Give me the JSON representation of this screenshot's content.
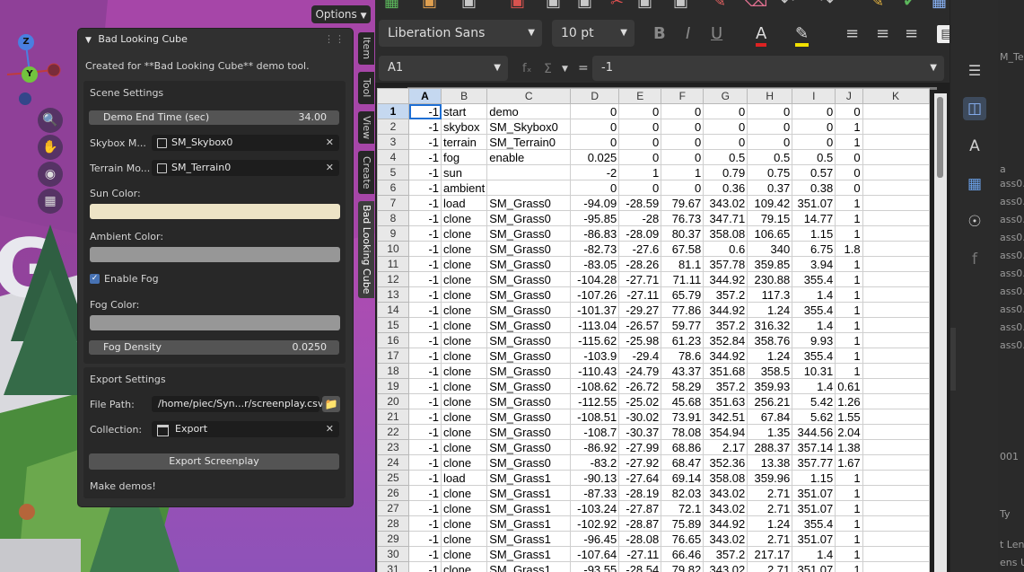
{
  "viewport": {
    "options_label": "Options",
    "axis_z": "Z",
    "axis_y": "Y",
    "nav_icons": [
      "zoom-icon",
      "hand-pan-icon",
      "camera-icon",
      "grid-icon"
    ]
  },
  "panel": {
    "title": "Bad Looking Cube",
    "description": "Created for **Bad Looking Cube** demo tool.",
    "scene_settings": {
      "header": "Scene Settings",
      "demo_end_time_label": "Demo End Time (sec)",
      "demo_end_time_value": "34.00",
      "skybox_label": "Skybox M...",
      "skybox_value": "SM_Skybox0",
      "terrain_label": "Terrain Mo...",
      "terrain_value": "SM_Terrain0",
      "sun_color_label": "Sun Color:",
      "sun_color": "#ede4c6",
      "ambient_color_label": "Ambient Color:",
      "ambient_color": "#979797",
      "enable_fog_label": "Enable Fog",
      "enable_fog": true,
      "fog_color_label": "Fog Color:",
      "fog_color": "#979797",
      "fog_density_label": "Fog Density",
      "fog_density_value": "0.0250"
    },
    "export_settings": {
      "header": "Export Settings",
      "file_path_label": "File Path:",
      "file_path_value": "/home/piec/Syn...r/screenplay.csv",
      "collection_label": "Collection:",
      "collection_value": "Export",
      "export_button": "Export Screenplay",
      "footer_text": "Make demos!"
    }
  },
  "side_tabs": [
    "Item",
    "Tool",
    "View",
    "Create",
    "Bad Looking Cube"
  ],
  "sheet": {
    "font_name": "Liberation Sans",
    "font_size": "10 pt",
    "cell_ref": "A1",
    "formula_value": "-1",
    "columns": [
      "A",
      "B",
      "C",
      "D",
      "E",
      "F",
      "G",
      "H",
      "I",
      "J",
      "K"
    ],
    "rows": [
      [
        "1",
        "-1",
        "start",
        "demo",
        "0",
        "0",
        "0",
        "0",
        "0",
        "0",
        "0"
      ],
      [
        "2",
        "-1",
        "skybox",
        "SM_Skybox0",
        "0",
        "0",
        "0",
        "0",
        "0",
        "0",
        "1"
      ],
      [
        "3",
        "-1",
        "terrain",
        "SM_Terrain0",
        "0",
        "0",
        "0",
        "0",
        "0",
        "0",
        "1"
      ],
      [
        "4",
        "-1",
        "fog",
        "enable",
        "0.025",
        "0",
        "0",
        "0.5",
        "0.5",
        "0.5",
        "0"
      ],
      [
        "5",
        "-1",
        "sun",
        "",
        "-2",
        "1",
        "1",
        "0.79",
        "0.75",
        "0.57",
        "0"
      ],
      [
        "6",
        "-1",
        "ambient",
        "",
        "0",
        "0",
        "0",
        "0.36",
        "0.37",
        "0.38",
        "0"
      ],
      [
        "7",
        "-1",
        "load",
        "SM_Grass0",
        "-94.09",
        "-28.59",
        "79.67",
        "343.02",
        "109.42",
        "351.07",
        "1"
      ],
      [
        "8",
        "-1",
        "clone",
        "SM_Grass0",
        "-95.85",
        "-28",
        "76.73",
        "347.71",
        "79.15",
        "14.77",
        "1"
      ],
      [
        "9",
        "-1",
        "clone",
        "SM_Grass0",
        "-86.83",
        "-28.09",
        "80.37",
        "358.08",
        "106.65",
        "1.15",
        "1"
      ],
      [
        "10",
        "-1",
        "clone",
        "SM_Grass0",
        "-82.73",
        "-27.6",
        "67.58",
        "0.6",
        "340",
        "6.75",
        "1.8"
      ],
      [
        "11",
        "-1",
        "clone",
        "SM_Grass0",
        "-83.05",
        "-28.26",
        "81.1",
        "357.78",
        "359.85",
        "3.94",
        "1"
      ],
      [
        "12",
        "-1",
        "clone",
        "SM_Grass0",
        "-104.28",
        "-27.71",
        "71.11",
        "344.92",
        "230.88",
        "355.4",
        "1"
      ],
      [
        "13",
        "-1",
        "clone",
        "SM_Grass0",
        "-107.26",
        "-27.11",
        "65.79",
        "357.2",
        "117.3",
        "1.4",
        "1"
      ],
      [
        "14",
        "-1",
        "clone",
        "SM_Grass0",
        "-101.37",
        "-29.27",
        "77.86",
        "344.92",
        "1.24",
        "355.4",
        "1"
      ],
      [
        "15",
        "-1",
        "clone",
        "SM_Grass0",
        "-113.04",
        "-26.57",
        "59.77",
        "357.2",
        "316.32",
        "1.4",
        "1"
      ],
      [
        "16",
        "-1",
        "clone",
        "SM_Grass0",
        "-115.62",
        "-25.98",
        "61.23",
        "352.84",
        "358.76",
        "9.93",
        "1"
      ],
      [
        "17",
        "-1",
        "clone",
        "SM_Grass0",
        "-103.9",
        "-29.4",
        "78.6",
        "344.92",
        "1.24",
        "355.4",
        "1"
      ],
      [
        "18",
        "-1",
        "clone",
        "SM_Grass0",
        "-110.43",
        "-24.79",
        "43.37",
        "351.68",
        "358.5",
        "10.31",
        "1"
      ],
      [
        "19",
        "-1",
        "clone",
        "SM_Grass0",
        "-108.62",
        "-26.72",
        "58.29",
        "357.2",
        "359.93",
        "1.4",
        "0.61"
      ],
      [
        "20",
        "-1",
        "clone",
        "SM_Grass0",
        "-112.55",
        "-25.02",
        "45.68",
        "351.63",
        "256.21",
        "5.42",
        "1.26"
      ],
      [
        "21",
        "-1",
        "clone",
        "SM_Grass0",
        "-108.51",
        "-30.02",
        "73.91",
        "342.51",
        "67.84",
        "5.62",
        "1.55"
      ],
      [
        "22",
        "-1",
        "clone",
        "SM_Grass0",
        "-108.7",
        "-30.37",
        "78.08",
        "354.94",
        "1.35",
        "344.56",
        "2.04"
      ],
      [
        "23",
        "-1",
        "clone",
        "SM_Grass0",
        "-86.92",
        "-27.99",
        "68.86",
        "2.17",
        "288.37",
        "357.14",
        "1.38"
      ],
      [
        "24",
        "-1",
        "clone",
        "SM_Grass0",
        "-83.2",
        "-27.92",
        "68.47",
        "352.36",
        "13.38",
        "357.77",
        "1.67"
      ],
      [
        "25",
        "-1",
        "load",
        "SM_Grass1",
        "-90.13",
        "-27.64",
        "69.14",
        "358.08",
        "359.96",
        "1.15",
        "1"
      ],
      [
        "26",
        "-1",
        "clone",
        "SM_Grass1",
        "-87.33",
        "-28.19",
        "82.03",
        "343.02",
        "2.71",
        "351.07",
        "1"
      ],
      [
        "27",
        "-1",
        "clone",
        "SM_Grass1",
        "-103.24",
        "-27.87",
        "72.1",
        "343.02",
        "2.71",
        "351.07",
        "1"
      ],
      [
        "28",
        "-1",
        "clone",
        "SM_Grass1",
        "-102.92",
        "-28.87",
        "75.89",
        "344.92",
        "1.24",
        "355.4",
        "1"
      ],
      [
        "29",
        "-1",
        "clone",
        "SM_Grass1",
        "-96.45",
        "-28.08",
        "76.65",
        "343.02",
        "2.71",
        "351.07",
        "1"
      ],
      [
        "30",
        "-1",
        "clone",
        "SM_Grass1",
        "-107.64",
        "-27.11",
        "66.46",
        "357.2",
        "217.17",
        "1.4",
        "1"
      ],
      [
        "31",
        "-1",
        "clone",
        "SM_Grass1",
        "-93.55",
        "-28.54",
        "79.82",
        "343.02",
        "2.71",
        "351.07",
        "1"
      ]
    ]
  },
  "background_window": {
    "items": [
      "M_Ter",
      "a",
      "ass0.",
      "ass0.",
      "ass0.",
      "ass0.",
      "ass0.",
      "ass0.",
      "ass0.",
      "ass0.",
      "ass0.",
      "ass0.",
      "001",
      "Ty",
      "t Leng",
      "ens U"
    ]
  }
}
